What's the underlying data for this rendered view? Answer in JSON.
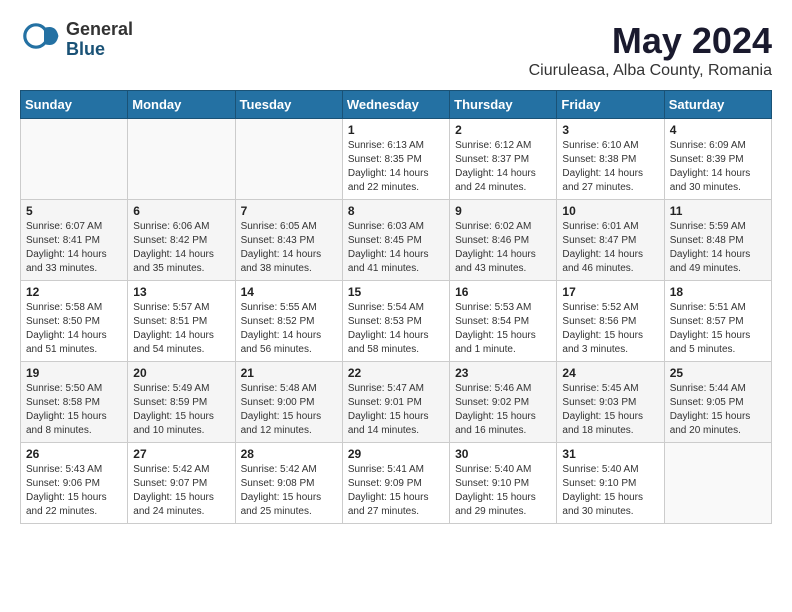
{
  "header": {
    "logo": {
      "general": "General",
      "blue": "Blue"
    },
    "title": "May 2024",
    "subtitle": "Ciuruleasa, Alba County, Romania"
  },
  "weekdays": [
    "Sunday",
    "Monday",
    "Tuesday",
    "Wednesday",
    "Thursday",
    "Friday",
    "Saturday"
  ],
  "weeks": [
    [
      {
        "day": "",
        "content": ""
      },
      {
        "day": "",
        "content": ""
      },
      {
        "day": "",
        "content": ""
      },
      {
        "day": "1",
        "content": "Sunrise: 6:13 AM\nSunset: 8:35 PM\nDaylight: 14 hours\nand 22 minutes."
      },
      {
        "day": "2",
        "content": "Sunrise: 6:12 AM\nSunset: 8:37 PM\nDaylight: 14 hours\nand 24 minutes."
      },
      {
        "day": "3",
        "content": "Sunrise: 6:10 AM\nSunset: 8:38 PM\nDaylight: 14 hours\nand 27 minutes."
      },
      {
        "day": "4",
        "content": "Sunrise: 6:09 AM\nSunset: 8:39 PM\nDaylight: 14 hours\nand 30 minutes."
      }
    ],
    [
      {
        "day": "5",
        "content": "Sunrise: 6:07 AM\nSunset: 8:41 PM\nDaylight: 14 hours\nand 33 minutes."
      },
      {
        "day": "6",
        "content": "Sunrise: 6:06 AM\nSunset: 8:42 PM\nDaylight: 14 hours\nand 35 minutes."
      },
      {
        "day": "7",
        "content": "Sunrise: 6:05 AM\nSunset: 8:43 PM\nDaylight: 14 hours\nand 38 minutes."
      },
      {
        "day": "8",
        "content": "Sunrise: 6:03 AM\nSunset: 8:45 PM\nDaylight: 14 hours\nand 41 minutes."
      },
      {
        "day": "9",
        "content": "Sunrise: 6:02 AM\nSunset: 8:46 PM\nDaylight: 14 hours\nand 43 minutes."
      },
      {
        "day": "10",
        "content": "Sunrise: 6:01 AM\nSunset: 8:47 PM\nDaylight: 14 hours\nand 46 minutes."
      },
      {
        "day": "11",
        "content": "Sunrise: 5:59 AM\nSunset: 8:48 PM\nDaylight: 14 hours\nand 49 minutes."
      }
    ],
    [
      {
        "day": "12",
        "content": "Sunrise: 5:58 AM\nSunset: 8:50 PM\nDaylight: 14 hours\nand 51 minutes."
      },
      {
        "day": "13",
        "content": "Sunrise: 5:57 AM\nSunset: 8:51 PM\nDaylight: 14 hours\nand 54 minutes."
      },
      {
        "day": "14",
        "content": "Sunrise: 5:55 AM\nSunset: 8:52 PM\nDaylight: 14 hours\nand 56 minutes."
      },
      {
        "day": "15",
        "content": "Sunrise: 5:54 AM\nSunset: 8:53 PM\nDaylight: 14 hours\nand 58 minutes."
      },
      {
        "day": "16",
        "content": "Sunrise: 5:53 AM\nSunset: 8:54 PM\nDaylight: 15 hours\nand 1 minute."
      },
      {
        "day": "17",
        "content": "Sunrise: 5:52 AM\nSunset: 8:56 PM\nDaylight: 15 hours\nand 3 minutes."
      },
      {
        "day": "18",
        "content": "Sunrise: 5:51 AM\nSunset: 8:57 PM\nDaylight: 15 hours\nand 5 minutes."
      }
    ],
    [
      {
        "day": "19",
        "content": "Sunrise: 5:50 AM\nSunset: 8:58 PM\nDaylight: 15 hours\nand 8 minutes."
      },
      {
        "day": "20",
        "content": "Sunrise: 5:49 AM\nSunset: 8:59 PM\nDaylight: 15 hours\nand 10 minutes."
      },
      {
        "day": "21",
        "content": "Sunrise: 5:48 AM\nSunset: 9:00 PM\nDaylight: 15 hours\nand 12 minutes."
      },
      {
        "day": "22",
        "content": "Sunrise: 5:47 AM\nSunset: 9:01 PM\nDaylight: 15 hours\nand 14 minutes."
      },
      {
        "day": "23",
        "content": "Sunrise: 5:46 AM\nSunset: 9:02 PM\nDaylight: 15 hours\nand 16 minutes."
      },
      {
        "day": "24",
        "content": "Sunrise: 5:45 AM\nSunset: 9:03 PM\nDaylight: 15 hours\nand 18 minutes."
      },
      {
        "day": "25",
        "content": "Sunrise: 5:44 AM\nSunset: 9:05 PM\nDaylight: 15 hours\nand 20 minutes."
      }
    ],
    [
      {
        "day": "26",
        "content": "Sunrise: 5:43 AM\nSunset: 9:06 PM\nDaylight: 15 hours\nand 22 minutes."
      },
      {
        "day": "27",
        "content": "Sunrise: 5:42 AM\nSunset: 9:07 PM\nDaylight: 15 hours\nand 24 minutes."
      },
      {
        "day": "28",
        "content": "Sunrise: 5:42 AM\nSunset: 9:08 PM\nDaylight: 15 hours\nand 25 minutes."
      },
      {
        "day": "29",
        "content": "Sunrise: 5:41 AM\nSunset: 9:09 PM\nDaylight: 15 hours\nand 27 minutes."
      },
      {
        "day": "30",
        "content": "Sunrise: 5:40 AM\nSunset: 9:10 PM\nDaylight: 15 hours\nand 29 minutes."
      },
      {
        "day": "31",
        "content": "Sunrise: 5:40 AM\nSunset: 9:10 PM\nDaylight: 15 hours\nand 30 minutes."
      },
      {
        "day": "",
        "content": ""
      }
    ]
  ]
}
